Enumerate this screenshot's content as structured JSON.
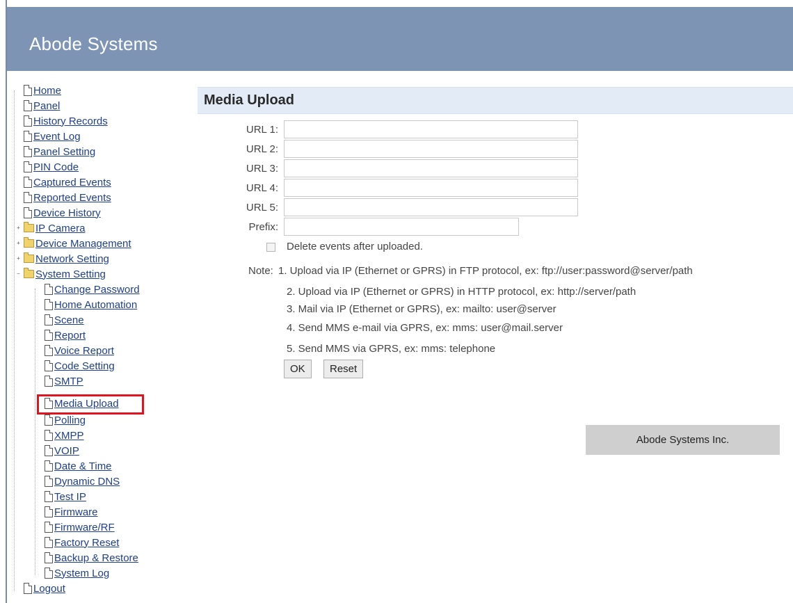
{
  "header": {
    "title": "Abode Systems"
  },
  "sidebar": {
    "items": [
      {
        "label": "Home",
        "type": "doc"
      },
      {
        "label": "Panel",
        "type": "doc"
      },
      {
        "label": "History Records",
        "type": "doc"
      },
      {
        "label": "Event Log",
        "type": "doc"
      },
      {
        "label": "Panel Setting",
        "type": "doc"
      },
      {
        "label": "PIN Code",
        "type": "doc"
      },
      {
        "label": "Captured Events",
        "type": "doc"
      },
      {
        "label": "Reported Events",
        "type": "doc"
      },
      {
        "label": "Device History",
        "type": "doc"
      },
      {
        "label": "IP Camera",
        "type": "folder"
      },
      {
        "label": "Device Management",
        "type": "folder"
      },
      {
        "label": "Network Setting",
        "type": "folder"
      },
      {
        "label": "System Setting",
        "type": "folder-open"
      }
    ],
    "system_setting_children": [
      "Change Password",
      "Home Automation",
      "Scene",
      "Report",
      "Voice Report",
      "Code Setting",
      "SMTP",
      "Media Upload",
      "Polling",
      "XMPP",
      "VOIP",
      "Date & Time",
      "Dynamic DNS",
      "Test IP",
      "Firmware",
      "Firmware/RF",
      "Factory Reset",
      "Backup & Restore",
      "System Log"
    ],
    "logout": "Logout",
    "selected": "Media Upload"
  },
  "main": {
    "title": "Media Upload",
    "fields": [
      {
        "label": "URL 1:",
        "value": ""
      },
      {
        "label": "URL 2:",
        "value": ""
      },
      {
        "label": "URL 3:",
        "value": ""
      },
      {
        "label": "URL 4:",
        "value": ""
      },
      {
        "label": "URL 5:",
        "value": ""
      }
    ],
    "prefix": {
      "label": "Prefix:",
      "value": ""
    },
    "delete_events": {
      "label": "Delete events after uploaded.",
      "checked": false
    },
    "note_label": "Note:",
    "notes": [
      "1. Upload via IP (Ethernet or GPRS) in FTP protocol, ex: ftp://user:password@server/path",
      "2. Upload via IP (Ethernet or GPRS) in HTTP protocol, ex: http://server/path",
      "3. Mail via IP (Ethernet or GPRS), ex: mailto: user@server",
      "4. Send MMS e-mail via GPRS, ex: mms: user@mail.server",
      "5. Send MMS via GPRS, ex: mms: telephone"
    ],
    "ok_label": "OK",
    "reset_label": "Reset"
  },
  "footer": {
    "company": "Abode Systems Inc."
  }
}
